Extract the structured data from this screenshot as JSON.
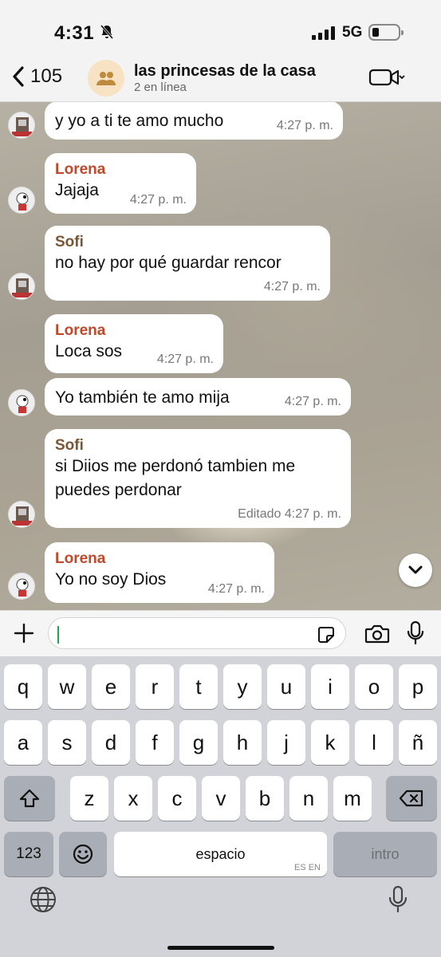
{
  "status_bar": {
    "time": "4:31",
    "network": "5G"
  },
  "header": {
    "back_count": "105",
    "title": "las princesas de la casa",
    "subtitle": "2 en línea"
  },
  "messages": [
    {
      "sender": "",
      "text": "y yo a ti te amo mucho",
      "time": "4:27 p. m."
    },
    {
      "sender": "Lorena",
      "text": "Jajaja",
      "time": "4:27 p. m."
    },
    {
      "sender": "Sofi",
      "text": "no hay por qué guardar rencor",
      "time": "4:27 p. m."
    },
    {
      "sender": "Lorena",
      "text": "Loca sos",
      "time": "4:27 p. m."
    },
    {
      "sender": "",
      "text": "Yo también te amo mija",
      "time": "4:27 p. m."
    },
    {
      "sender": "Sofi",
      "text": "si Diios me perdonó tambien me",
      "text2": "puedes perdonar",
      "time": "Editado 4:27 p. m."
    },
    {
      "sender": "Lorena",
      "text": "Yo no soy Dios",
      "time": "4:27 p. m."
    }
  ],
  "composer": {
    "value": "",
    "placeholder": ""
  },
  "keyboard": {
    "row1": [
      "q",
      "w",
      "e",
      "r",
      "t",
      "y",
      "u",
      "i",
      "o",
      "p"
    ],
    "row2": [
      "a",
      "s",
      "d",
      "f",
      "g",
      "h",
      "j",
      "k",
      "l",
      "ñ"
    ],
    "row3": [
      "z",
      "x",
      "c",
      "v",
      "b",
      "n",
      "m"
    ],
    "numbers_label": "123",
    "space_label": "espacio",
    "space_sub": "ES EN",
    "return_label": "intro"
  },
  "colors": {
    "lorena": "#c2472b",
    "sofi": "#7a5634",
    "accent": "#1da657"
  },
  "icons": [
    "back-chevron-icon",
    "group-icon",
    "video-call-icon",
    "silent-bell-icon",
    "plus-icon",
    "sticker-icon",
    "camera-icon",
    "microphone-icon",
    "shift-icon",
    "delete-icon",
    "emoji-icon",
    "globe-icon",
    "chevron-down-icon"
  ]
}
